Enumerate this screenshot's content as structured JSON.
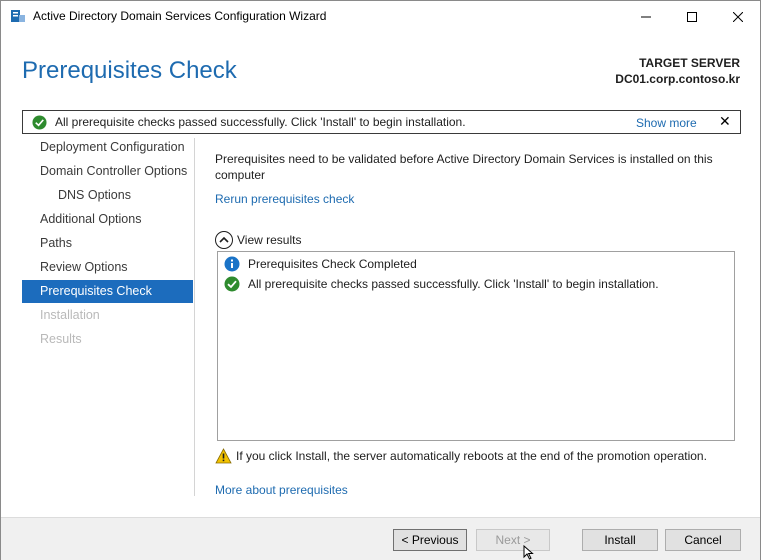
{
  "window": {
    "title": "Active Directory Domain Services Configuration Wizard",
    "controls": [
      "minimize-icon",
      "maximize-icon",
      "close-icon"
    ]
  },
  "header": {
    "page_title": "Prerequisites Check",
    "target_label": "TARGET SERVER",
    "target_server": "DC01.corp.contoso.kr"
  },
  "notification": {
    "message": "All prerequisite checks passed successfully.  Click 'Install' to begin installation.",
    "show_more": "Show more",
    "close": "✕"
  },
  "sidebar": {
    "items": [
      {
        "label": "Deployment Configuration",
        "state": "normal"
      },
      {
        "label": "Domain Controller Options",
        "state": "normal"
      },
      {
        "label": "DNS Options",
        "state": "sub"
      },
      {
        "label": "Additional Options",
        "state": "normal"
      },
      {
        "label": "Paths",
        "state": "normal"
      },
      {
        "label": "Review Options",
        "state": "normal"
      },
      {
        "label": "Prerequisites Check",
        "state": "active"
      },
      {
        "label": "Installation",
        "state": "disabled"
      },
      {
        "label": "Results",
        "state": "disabled"
      }
    ]
  },
  "content": {
    "intro": "Prerequisites need to be validated before Active Directory Domain Services is installed on this computer",
    "rerun": "Rerun prerequisites check",
    "view_results": "View results",
    "results": [
      {
        "icon": "info-icon",
        "text": "Prerequisites Check Completed"
      },
      {
        "icon": "check-circle-icon",
        "text": "All prerequisite checks passed successfully.  Click 'Install' to begin installation."
      }
    ],
    "warning": "If you click Install, the server automatically reboots at the end of the promotion operation.",
    "more_link": "More about prerequisites"
  },
  "footer": {
    "previous": "< Previous",
    "next": "Next >",
    "install": "Install",
    "cancel": "Cancel"
  },
  "colors": {
    "accent": "#1e6bb0",
    "active_nav": "#1c6cbd",
    "success": "#2e8b2e",
    "info": "#1a73c7",
    "warning": "#f2c200"
  }
}
